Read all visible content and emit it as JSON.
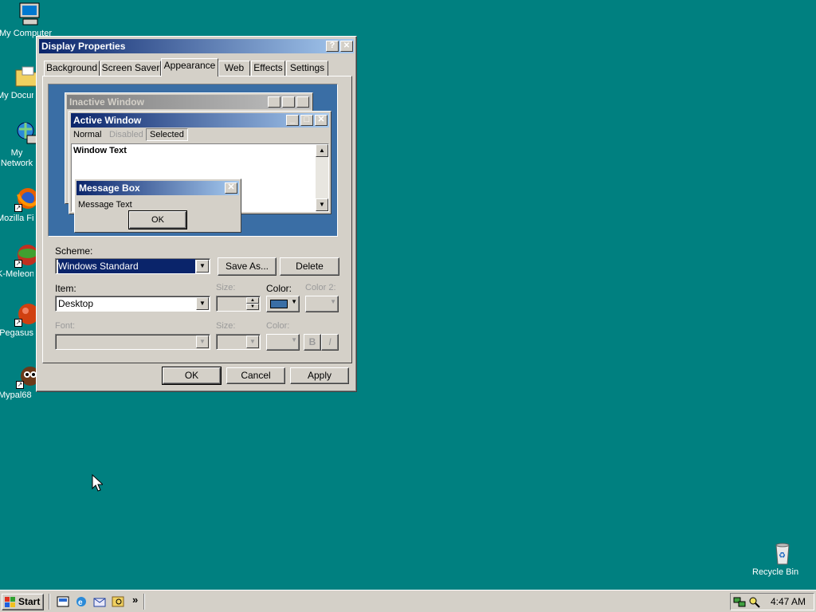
{
  "desktop": {
    "icons": [
      {
        "label": "My Computer"
      },
      {
        "label": "My Documents"
      },
      {
        "label": "My Network Places"
      },
      {
        "label": "Mozilla Firefox"
      },
      {
        "label": "K-Meleon"
      },
      {
        "label": "Pegasus"
      },
      {
        "label": "Mypal68"
      }
    ],
    "recycle_bin": {
      "label": "Recycle Bin"
    }
  },
  "dialog": {
    "title": "Display Properties",
    "help_glyph": "?",
    "close_glyph": "✕",
    "tabs": [
      {
        "label": "Background"
      },
      {
        "label": "Screen Saver"
      },
      {
        "label": "Appearance"
      },
      {
        "label": "Web"
      },
      {
        "label": "Effects"
      },
      {
        "label": "Settings"
      }
    ],
    "active_tab": "Appearance",
    "preview": {
      "inactive_title": "Inactive Window",
      "active_title": "Active Window",
      "menu": {
        "normal": "Normal",
        "disabled": "Disabled",
        "selected": "Selected"
      },
      "window_text": "Window Text",
      "message_box_title": "Message Box",
      "message_text": "Message Text",
      "ok_label": "OK"
    },
    "scheme": {
      "label": "Scheme:",
      "value": "Windows Standard",
      "save_as": "Save As...",
      "delete": "Delete"
    },
    "item": {
      "label": "Item:",
      "value": "Desktop",
      "size_label": "Size:",
      "color_label": "Color:",
      "color2_label": "Color 2:",
      "color_value": "#3a6ea5"
    },
    "font": {
      "label": "Font:",
      "size_label": "Size:",
      "color_label": "Color:",
      "bold": "B",
      "italic": "I"
    },
    "buttons": {
      "ok": "OK",
      "cancel": "Cancel",
      "apply": "Apply"
    }
  },
  "taskbar": {
    "start_label": "Start",
    "chevron": "»",
    "clock": "4:47 AM"
  }
}
